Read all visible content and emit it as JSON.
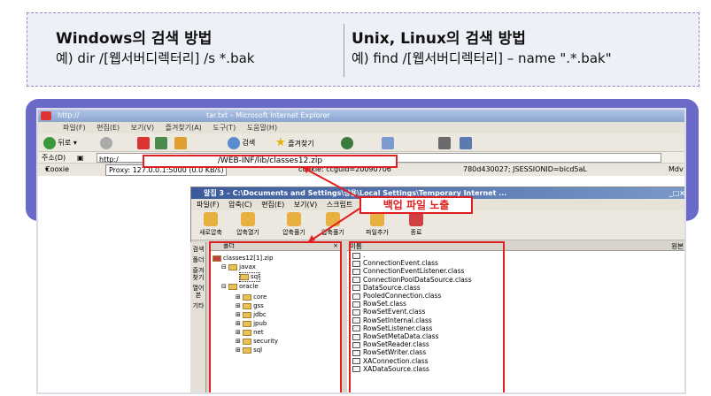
{
  "windows": {
    "title": "Windows의 검색 방법",
    "example": "예) dir /[웹서버디렉터리] /s *.bak"
  },
  "unix": {
    "title": "Unix, Linux의 검색 방법",
    "example": "예) find /[웹서버디렉터리] – name \".*.bak\""
  },
  "ie": {
    "prefix": "http://",
    "title": "tar.txt – Microsoft Internet Explorer",
    "menu": "파일(F) 편집(E) 보기(V) 즐겨찾기(A) 도구(T) 도움말(H)",
    "back": "뒤로",
    "search": "검색",
    "favorites": "즐겨찾기",
    "address_label": "주소(D)",
    "address_prefix": "http:/",
    "url": "/WEB-INF/lib/classes12.zip",
    "cookie": "Cooxie",
    "proxy": "Proxy: 127.0.0.1:5000 (0.0 KB/s)",
    "cookie_info": "cookie: ccguid=20090706",
    "session": "780d430027; JSESSIONID=bicd5aL",
    "mdv": "Mdv"
  },
  "zip": {
    "title": "알집 3 – C:\\Documents and Settings\\상용\\Local Settings\\Temporary Internet ...",
    "menu": "파일(F) 압축(C) 편집(E) 보기(V) 스크립트",
    "tools": [
      "새로압축",
      "압축열기",
      "압축풀기",
      "압축풀기",
      "파일추가",
      "종료"
    ],
    "folder_header": "폴더",
    "name_header": "이름",
    "orig_header": "원본",
    "tree": [
      "classes12[1].zip",
      "javax",
      "sql",
      "oracle",
      "core",
      "gss",
      "jdbc",
      "jpub",
      "net",
      "security",
      "sql"
    ],
    "files": [
      ".",
      "ConnectionEvent.class",
      "ConnectionEventListener.class",
      "ConnectionPoolDataSource.class",
      "DataSource.class",
      "PooledConnection.class",
      "RowSet.class",
      "RowSetEvent.class",
      "RowSetInternal.class",
      "RowSetListener.class",
      "RowSetMetaData.class",
      "RowSetReader.class",
      "RowSetWriter.class",
      "XAConnection.class",
      "XADataSource.class"
    ],
    "side": [
      "검색",
      "폴더",
      "즐겨찾기",
      "열어본",
      "기타"
    ]
  },
  "callout": "백업 파일 노출",
  "colors": {
    "accent": "#e02020",
    "frame": "#6a6ac8"
  }
}
